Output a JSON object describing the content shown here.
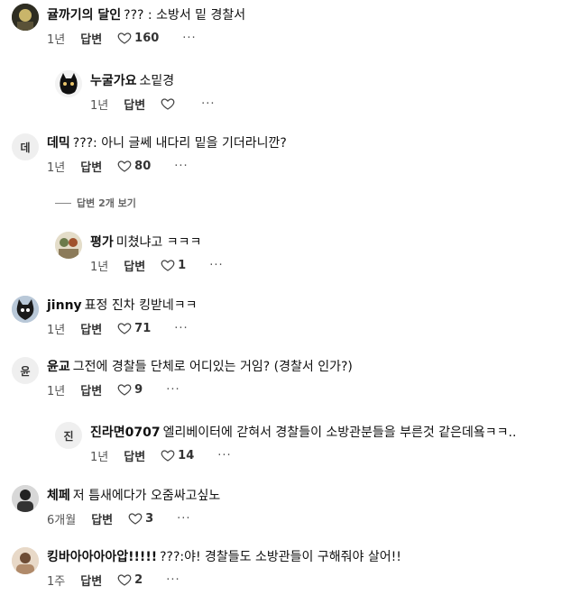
{
  "comments": [
    {
      "user": "귤까기의 달인",
      "text": "??? : 소방서 밑 경찰서",
      "time": "1년",
      "reply": "답변",
      "likes": "160",
      "more": "···"
    },
    {
      "user": "누굴가요",
      "text": "소밑경",
      "time": "1년",
      "reply": "답변",
      "likes": "",
      "more": "···"
    },
    {
      "user": "데믹",
      "text": "???: 아니 글쎄 내다리 밑을 기더라니깐?",
      "time": "1년",
      "reply": "답변",
      "likes": "80",
      "more": "···",
      "avatar_text": "데"
    },
    {
      "user": "평가",
      "text": "미쳤냐고 ㅋㅋㅋ",
      "time": "1년",
      "reply": "답변",
      "likes": "1",
      "more": "···"
    },
    {
      "user": "jinny",
      "text": "표정 진차 킹받네ㅋㅋ",
      "time": "1년",
      "reply": "답변",
      "likes": "71",
      "more": "···"
    },
    {
      "user": "윤교",
      "text": "그전에 경찰들 단체로 어디있는 거임? (경찰서 인가?)",
      "time": "1년",
      "reply": "답변",
      "likes": "9",
      "more": "···",
      "avatar_text": "윤"
    },
    {
      "user": "진라면0707",
      "text": "엘리베이터에 갇혀서 경찰들이 소방관분들을 부른것 같은데욬ㅋㅋ..",
      "time": "1년",
      "reply": "답변",
      "likes": "14",
      "more": "···",
      "avatar_text": "진"
    },
    {
      "user": "체페",
      "text": "저 틈새에다가 오줌싸고싶노",
      "time": "6개월",
      "reply": "답변",
      "likes": "3",
      "more": "···"
    },
    {
      "user": "킹바아아아아압!!!!!",
      "text": "???:야! 경찰들도 소방관들이 구해줘야 살어!!",
      "time": "1주",
      "reply": "답변",
      "likes": "2",
      "more": "···"
    }
  ],
  "view_replies": "답변 2개 보기",
  "colors": {
    "background": "#ffffff",
    "text": "#111111",
    "meta": "#555555",
    "avatar_bg": "#efefef"
  }
}
